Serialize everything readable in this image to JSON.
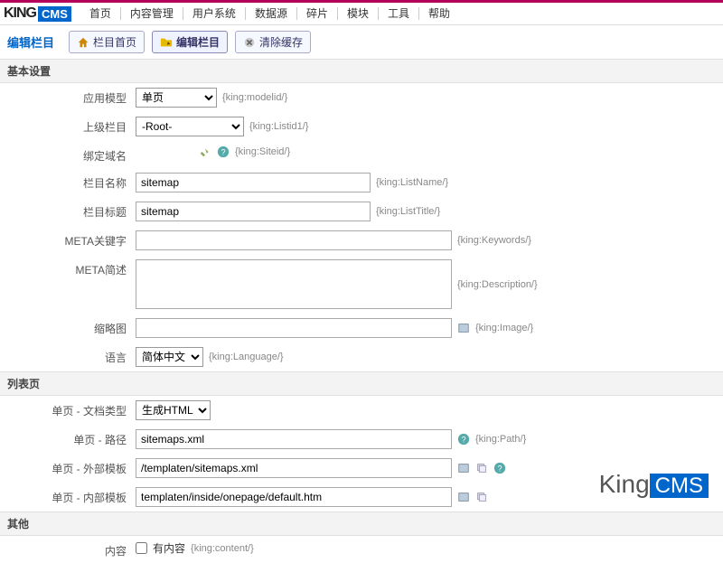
{
  "logo": {
    "king": "KING",
    "cms": "CMS"
  },
  "menu": [
    "首页",
    "内容管理",
    "用户系统",
    "数据源",
    "碎片",
    "模块",
    "工具",
    "帮助"
  ],
  "page_title": "编辑栏目",
  "toolbar": {
    "home": "栏目首页",
    "edit": "编辑栏目",
    "clear": "清除缓存"
  },
  "sections": {
    "basic": "基本设置",
    "list": "列表页",
    "other": "其他"
  },
  "fields": {
    "model": {
      "label": "应用模型",
      "value": "单页",
      "hint": "{king:modelid/}"
    },
    "parent": {
      "label": "上级栏目",
      "value": "-Root-",
      "hint": "{king:Listid1/}"
    },
    "domain": {
      "label": "绑定域名",
      "hint": "{king:Siteid/}"
    },
    "name": {
      "label": "栏目名称",
      "value": "sitemap",
      "hint": "{king:ListName/}"
    },
    "title": {
      "label": "栏目标题",
      "value": "sitemap",
      "hint": "{king:ListTitle/}"
    },
    "keywords": {
      "label": "META关键字",
      "value": "",
      "hint": "{king:Keywords/}"
    },
    "description": {
      "label": "META简述",
      "value": "",
      "hint": "{king:Description/}"
    },
    "thumb": {
      "label": "缩略图",
      "value": "",
      "hint": "{king:Image/}"
    },
    "language": {
      "label": "语言",
      "value": "简体中文",
      "hint": "{king:Language/}"
    },
    "doctype": {
      "label": "单页 - 文档类型",
      "value": "生成HTML"
    },
    "path": {
      "label": "单页 - 路径",
      "value": "sitemaps.xml",
      "hint": "{king:Path/}"
    },
    "out_tpl": {
      "label": "单页 - 外部模板",
      "value": "/templaten/sitemaps.xml"
    },
    "in_tpl": {
      "label": "单页 - 内部模板",
      "value": "templaten/inside/onepage/default.htm"
    },
    "content": {
      "label": "内容",
      "checkbox": "有内容",
      "hint": "{king:content/}"
    }
  },
  "watermark": {
    "king": "King",
    "cms": "CMS"
  }
}
